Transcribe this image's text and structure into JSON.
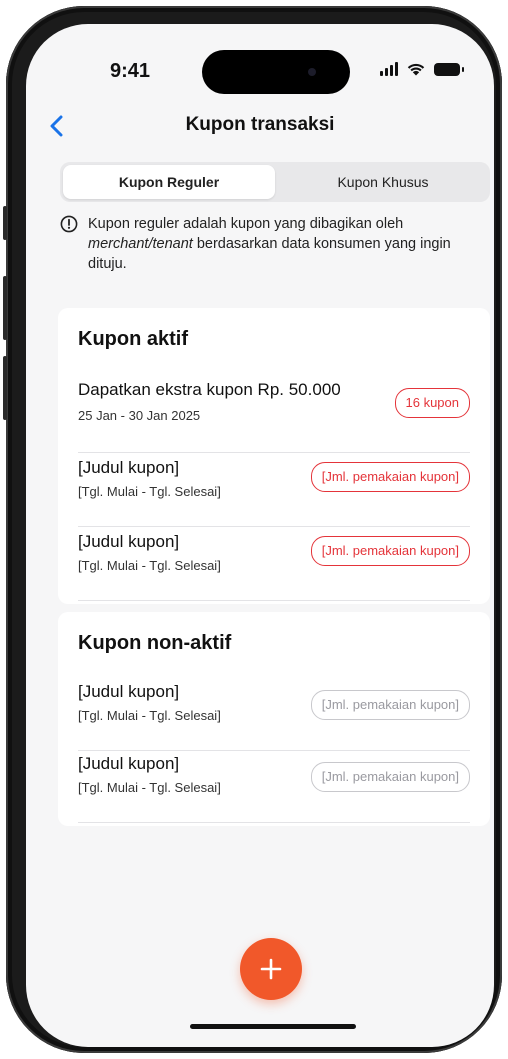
{
  "status_bar": {
    "time": "9:41"
  },
  "nav": {
    "title": "Kupon transaksi"
  },
  "tabs": [
    {
      "label": "Kupon Reguler",
      "active": true
    },
    {
      "label": "Kupon Khusus",
      "active": false
    }
  ],
  "info": {
    "text_before": "Kupon reguler adalah kupon yang dibagikan oleh ",
    "text_italic": "merchant/tenant",
    "text_after": " berdasarkan data konsumen yang ingin dituju."
  },
  "active_section": {
    "title": "Kupon aktif",
    "items": [
      {
        "title": "Dapatkan ekstra kupon Rp. 50.000",
        "date": "25 Jan - 30 Jan 2025",
        "badge": "16 kupon"
      },
      {
        "title": "[Judul kupon]",
        "date": "[Tgl. Mulai - Tgl. Selesai]",
        "badge": "[Jml. pemakaian kupon]"
      },
      {
        "title": "[Judul kupon]",
        "date": "[Tgl. Mulai - Tgl. Selesai]",
        "badge": "[Jml. pemakaian kupon]"
      }
    ]
  },
  "inactive_section": {
    "title": "Kupon non-aktif",
    "items": [
      {
        "title": "[Judul kupon]",
        "date": "[Tgl. Mulai - Tgl. Selesai]",
        "badge": "[Jml. pemakaian kupon]"
      },
      {
        "title": "[Judul kupon]",
        "date": "[Tgl. Mulai - Tgl. Selesai]",
        "badge": "[Jml. pemakaian kupon]"
      }
    ]
  },
  "icons": {
    "back": "chevron-left-icon",
    "info": "info-circle-icon",
    "add": "plus-icon"
  },
  "colors": {
    "accent": "#f1582a",
    "active_badge": "#e4343a",
    "inactive_badge": "#9a9aa0",
    "back_arrow": "#1a73e8"
  }
}
